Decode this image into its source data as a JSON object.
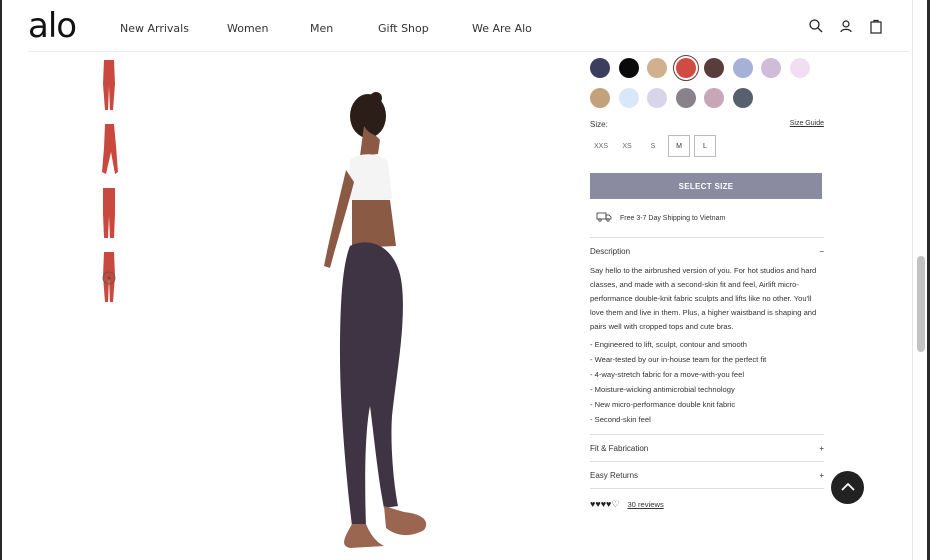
{
  "header": {
    "logo": "alo",
    "nav": [
      "New Arrivals",
      "Women",
      "Men",
      "Gift Shop",
      "We Are Alo"
    ],
    "icons": [
      "search-icon",
      "account-icon",
      "bag-icon"
    ]
  },
  "gallery": {
    "thumbnail_count": 4
  },
  "product": {
    "swatch_colors": [
      "#3b3f5c",
      "#0a0a0a",
      "#d0b08e",
      "#cf4b44",
      "#5a3c3c",
      "#a7b0d6",
      "#cfbcd8",
      "#f1dff1",
      "#c3a17a",
      "#d9e8f8",
      "#d8d4ea",
      "#8a8289",
      "#c7a6b6",
      "#56606e"
    ],
    "selected_swatch_index": 3,
    "size_label": "Size:",
    "size_guide": "Size Guide",
    "sizes": [
      "XXS",
      "XS",
      "S",
      "M",
      "L"
    ],
    "select_size": "SELECT SIZE",
    "shipping": "Free 3-7 Day Shipping to Vietnam",
    "description": {
      "title": "Description",
      "toggle": "−",
      "text": "Say hello to the airbrushed version of you. For hot studios and hard classes, and made with a second-skin fit and feel, Airlift micro-performance double-knit fabric sculpts and lifts like no other. You'll love them and live in them. Plus, a higher waistband is shaping and pairs well with cropped tops and cute bras.",
      "bullets": [
        "- Engineered to lift, sculpt, contour and smooth",
        "- Wear-tested by our in-house team for the perfect fit",
        "- 4-way-stretch fabric for a move-with-you feel",
        "- Moisture-wicking antimicrobial technology",
        "- New micro-performance double knit fabric",
        "- Second-skin feel"
      ]
    },
    "fit_fabrication": {
      "title": "Fit & Fabrication",
      "toggle": "+"
    },
    "easy_returns": {
      "title": "Easy Returns",
      "toggle": "+"
    },
    "rating": {
      "stars": "♥♥♥♥♡",
      "reviews": "30 reviews"
    }
  }
}
